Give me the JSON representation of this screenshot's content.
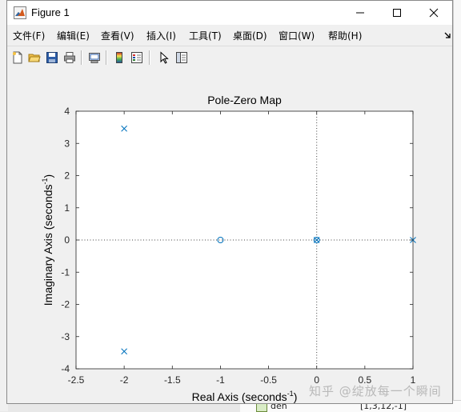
{
  "window": {
    "title": "Figure 1"
  },
  "menu": [
    {
      "label": "文件(F)"
    },
    {
      "label": "编辑(E)"
    },
    {
      "label": "查看(V)"
    },
    {
      "label": "插入(I)"
    },
    {
      "label": "工具(T)"
    },
    {
      "label": "桌面(D)"
    },
    {
      "label": "窗口(W)"
    },
    {
      "label": "帮助(H)"
    }
  ],
  "toolbar": {
    "icons": [
      "new-figure-icon",
      "open-file-icon",
      "save-icon",
      "print-icon",
      "link-plot-icon",
      "colorbar-icon",
      "legend-icon",
      "pointer-icon",
      "property-editor-icon"
    ]
  },
  "background": {
    "var_name": "den",
    "var_value": "[1,3,12,-1]",
    "watermark": "知乎 @绽放每一个瞬间"
  },
  "chart_data": {
    "type": "scatter",
    "title": "Pole-Zero Map",
    "xlabel": "Real Axis (seconds",
    "ylabel": "Imaginary Axis (seconds",
    "label_superscript": "-1",
    "label_suffix": ")",
    "xlim": [
      -2.5,
      1
    ],
    "ylim": [
      -4,
      4
    ],
    "xticks": [
      -2.5,
      -2,
      -1.5,
      -1,
      -0.5,
      0,
      0.5,
      1
    ],
    "xtick_labels": [
      "-2.5",
      "-2",
      "-1.5",
      "-1",
      "-0.5",
      "0",
      "0.5",
      "1"
    ],
    "yticks": [
      -4,
      -3,
      -2,
      -1,
      0,
      1,
      2,
      3,
      4
    ],
    "ytick_labels": [
      "-4",
      "-3",
      "-2",
      "-1",
      "0",
      "1",
      "2",
      "3",
      "4"
    ],
    "grid": false,
    "reference_lines": {
      "x": 0,
      "y": 0,
      "style": "dotted"
    },
    "series": [
      {
        "marker": "x",
        "points": [
          [
            -2,
            3.46
          ],
          [
            -2,
            -3.46
          ],
          [
            0,
            0
          ],
          [
            1,
            0
          ]
        ]
      },
      {
        "marker": "o",
        "points": [
          [
            -1,
            0
          ],
          [
            0,
            0
          ]
        ]
      }
    ],
    "colors": {
      "marker": "#0072BD",
      "axis": "#262626",
      "background": "#ffffff"
    }
  }
}
